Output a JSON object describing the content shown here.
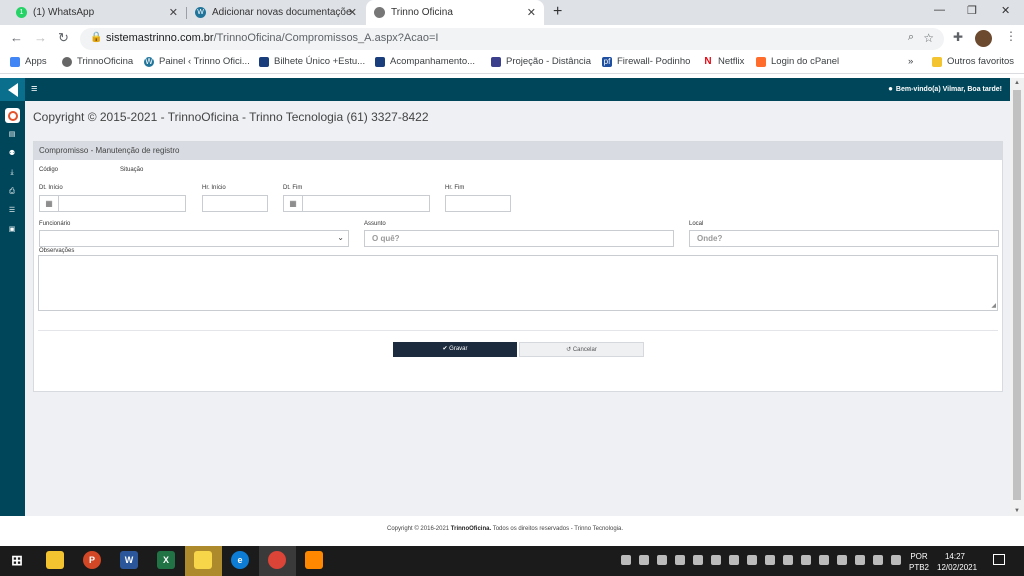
{
  "browser": {
    "tabs": [
      {
        "title": "(1) WhatsApp",
        "badge": "1"
      },
      {
        "title": "Adicionar novas documentaçõe"
      },
      {
        "title": "Trinno Oficina"
      }
    ],
    "url": {
      "host": "sistemastrinno.com.br",
      "path": "/TrinnoOficina/Compromissos_A.aspx?Acao=I"
    },
    "bookmarks": [
      {
        "label": "Apps"
      },
      {
        "label": "TrinnoOficina"
      },
      {
        "label": "Painel ‹ Trinno Ofici..."
      },
      {
        "label": "Bilhete Único +Estu..."
      },
      {
        "label": "Acompanhamento..."
      },
      {
        "label": "Projeção - Distância"
      },
      {
        "label": "Firewall- Podinho"
      },
      {
        "label": "Netflix"
      },
      {
        "label": "Login do cPanel"
      }
    ],
    "bookmarks_more": "»",
    "other_bookmarks": "Outros favoritos"
  },
  "app": {
    "header": {
      "welcome": "Bem-vindo(a) Vilmar, Boa tarde!"
    },
    "page_title": "Copyright © 2015-2021 - TrinnoOficina - Trinno Tecnologia (61) 3327-8422",
    "panel": {
      "title": "Compromisso - Manutenção de registro",
      "labels": {
        "codigo": "Código",
        "situacao": "Situação",
        "dt_inicio": "Dt. Início",
        "hr_inicio": "Hr. Início",
        "dt_fim": "Dt. Fim",
        "hr_fim": "Hr. Fim",
        "funcionario": "Funcionário",
        "assunto": "Assunto",
        "local": "Local",
        "observacoes": "Observações"
      },
      "placeholders": {
        "assunto": "O quê?",
        "local": "Onde?"
      },
      "buttons": {
        "save": "✔ Gravar",
        "cancel": "↺ Cancelar"
      }
    },
    "footer": {
      "prefix": "Copyright © 2016-2021 ",
      "brand": "TrinnoOficina.",
      "suffix": " Todos os direitos reservados - Trinno Tecnologia."
    }
  },
  "taskbar": {
    "lang": {
      "line1": "POR",
      "line2": "PTB2"
    },
    "clock": {
      "time": "14:27",
      "date": "12/02/2021"
    }
  }
}
